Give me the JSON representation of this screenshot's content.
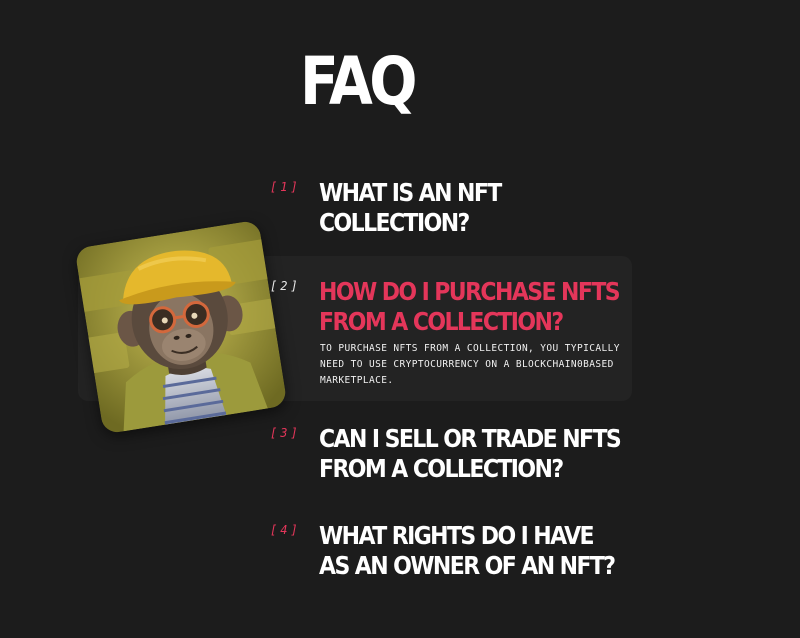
{
  "page": {
    "title": "FAQ"
  },
  "faq": {
    "items": [
      {
        "index": "[1]",
        "question_line1": "What is an NFT",
        "question_line2": "collection?"
      },
      {
        "index": "[2]",
        "question_line1": "How do I purchase NFTs",
        "question_line2": "from a collection?",
        "answer": "To purchase NFTs from a collection, you typically need to use cryptocurrency on a blockchain0based marketplace."
      },
      {
        "index": "[3]",
        "question_line1": "Can I sell or trade NFTs",
        "question_line2": "from a collection?"
      },
      {
        "index": "[4]",
        "question_line1": "What rights do I have",
        "question_line2": "as an owner of an NFT?"
      }
    ]
  },
  "colors": {
    "background": "#1c1c1c",
    "accent": "#e4365a",
    "card": "#232323",
    "text": "#ffffff"
  },
  "icons": {
    "nft_image": "ape-with-yellow-cap-and-glasses"
  }
}
